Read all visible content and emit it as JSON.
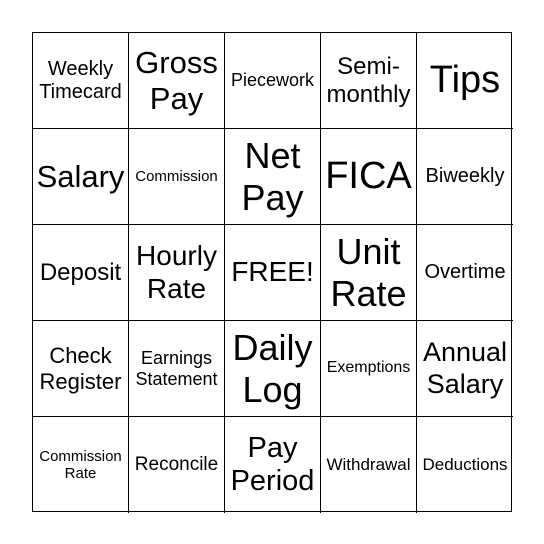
{
  "board": {
    "cells": [
      "Weekly Timecard",
      "Gross Pay",
      "Piecework",
      "Semi-monthly",
      "Tips",
      "Salary",
      "Commission",
      "Net Pay",
      "FICA",
      "Biweekly",
      "Deposit",
      "Hourly Rate",
      "FREE!",
      "Unit Rate",
      "Overtime",
      "Check Register",
      "Earnings Statement",
      "Daily Log",
      "Exemptions",
      "Annual Salary",
      "Commission Rate",
      "Reconcile",
      "Pay Period",
      "Withdrawal",
      "Deductions"
    ]
  }
}
